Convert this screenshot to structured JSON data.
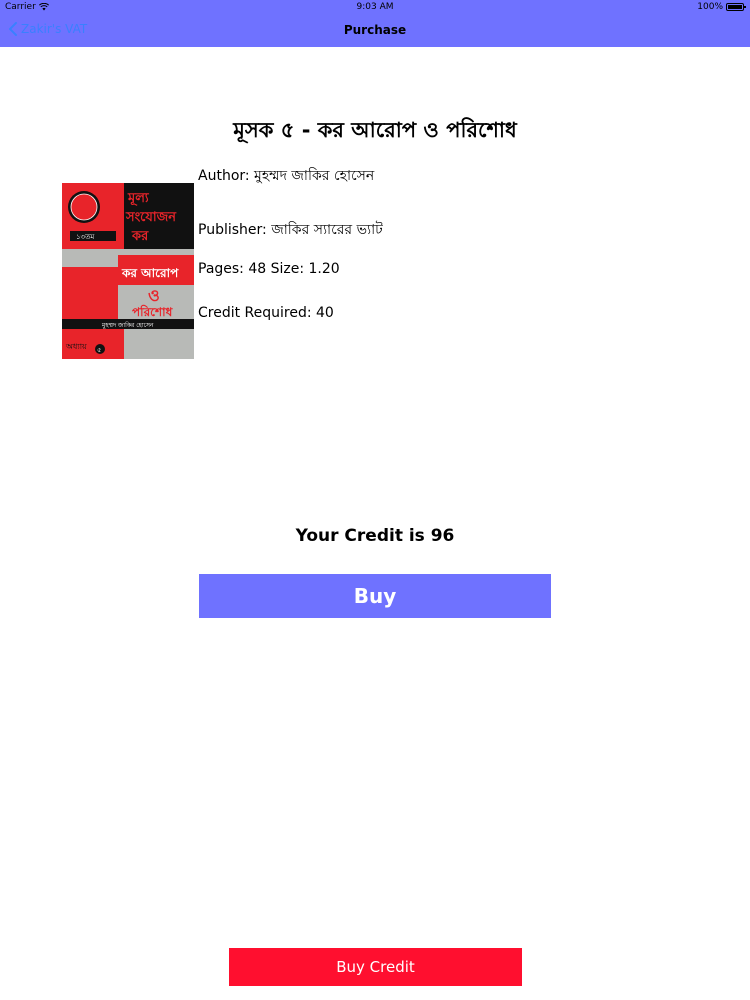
{
  "status_bar": {
    "carrier": "Carrier",
    "time": "9:03 AM",
    "battery": "100%"
  },
  "nav": {
    "back_label": "Zakir's VAT",
    "title": "Purchase"
  },
  "book": {
    "title": "মূসক ৫ - কর আরোপ ও পরিশোধ",
    "author": "Author: মুহম্মদ জাকির হোসেন",
    "publisher": "Publisher: জাকির স্যারের ভ্যাট",
    "pages_size": "Pages: 48 Size: 1.20",
    "credit_required": "Credit Required: 40",
    "cover": {
      "line1": "মূল্য",
      "line2": "সংযোজন",
      "line3": "কর",
      "line4": "কর আরোপ",
      "line5": "ও",
      "line6": "পরিশোধ",
      "author_strip": "মুহম্মদ জাকির হোসেন",
      "edition": "১৩তম",
      "chapter": "অধ্যায়",
      "chapter_num": "৫",
      "colors": {
        "red": "#e8242a",
        "gray": "#b8bab7",
        "black": "#111111"
      }
    }
  },
  "credit": {
    "balance_text": "Your Credit is 96"
  },
  "buttons": {
    "buy_label": "Buy",
    "buy_credit_label": "Buy Credit"
  },
  "colors": {
    "header": "#6f72ff",
    "back_link": "#3a80ff",
    "buy_button": "#6f72ff",
    "buy_credit_button": "#ff0f2f"
  }
}
